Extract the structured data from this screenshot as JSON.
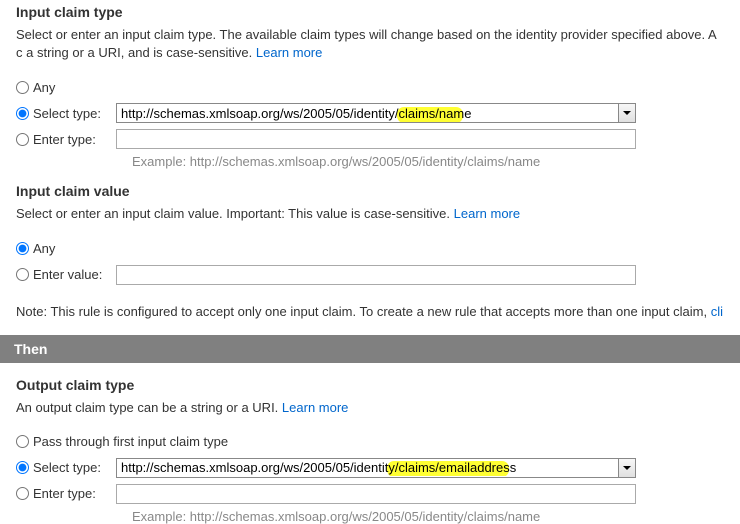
{
  "inputClaimType": {
    "header": "Input claim type",
    "desc_before": "Select or enter an input claim type. The available claim types will change based on the identity provider specified above. A c a string or a URI, and is case-sensitive. ",
    "learn_more": "Learn more",
    "any": "Any",
    "select_label": "Select type:",
    "select_value": "http://schemas.xmlsoap.org/ws/2005/05/identity/claims/name",
    "enter_label": "Enter type:",
    "enter_value": "",
    "example": "Example: http://schemas.xmlsoap.org/ws/2005/05/identity/claims/name"
  },
  "inputClaimValue": {
    "header": "Input claim value",
    "desc_before": "Select or enter an input claim value. Important: This value is case-sensitive. ",
    "learn_more": "Learn more",
    "any": "Any",
    "enter_label": "Enter value:",
    "enter_value": ""
  },
  "note": {
    "prefix": "Note: This rule is configured to accept only one input claim. To create a new rule that accepts more than one input claim, ",
    "link": "cli"
  },
  "then": {
    "label": "Then"
  },
  "outputClaimType": {
    "header": "Output claim type",
    "desc_before": "An output claim type can be a string or a URI. ",
    "learn_more": "Learn more",
    "pass_through": "Pass through first input claim type",
    "select_label": "Select type:",
    "select_value": "http://schemas.xmlsoap.org/ws/2005/05/identity/claims/emailaddress",
    "enter_label": "Enter type:",
    "enter_value": "",
    "example": "Example: http://schemas.xmlsoap.org/ws/2005/05/identity/claims/name"
  }
}
